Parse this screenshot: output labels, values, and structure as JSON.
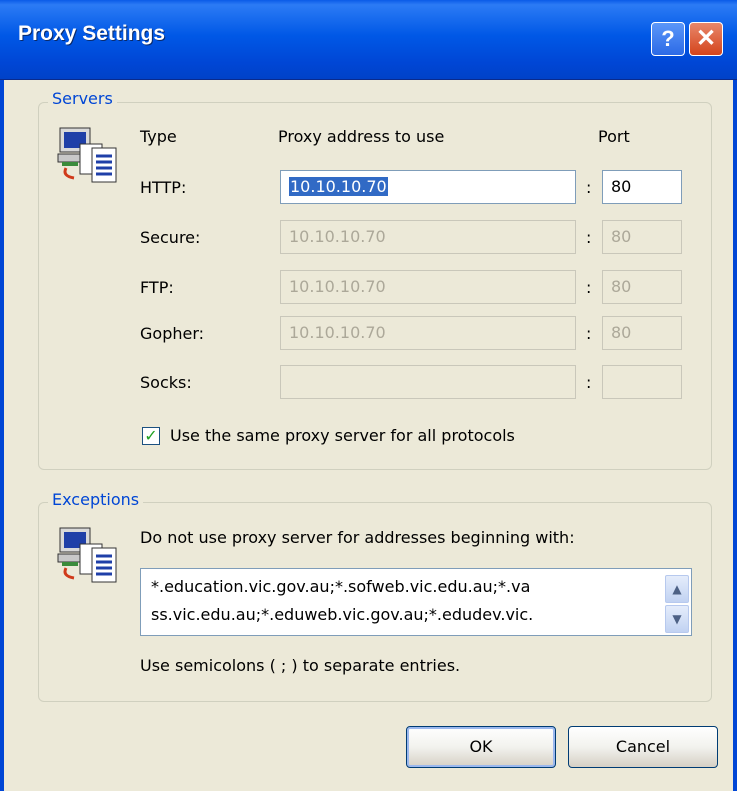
{
  "window": {
    "title": "Proxy Settings",
    "help_label": "?",
    "close_label": "✕"
  },
  "servers": {
    "legend": "Servers",
    "type_header": "Type",
    "address_header": "Proxy address to use",
    "port_header": "Port",
    "rows": [
      {
        "type": "HTTP:",
        "address": "10.10.10.70",
        "port": "80",
        "enabled": true
      },
      {
        "type": "Secure:",
        "address": "10.10.10.70",
        "port": "80",
        "enabled": false
      },
      {
        "type": "FTP:",
        "address": "10.10.10.70",
        "port": "80",
        "enabled": false
      },
      {
        "type": "Gopher:",
        "address": "10.10.10.70",
        "port": "80",
        "enabled": false
      },
      {
        "type": "Socks:",
        "address": "",
        "port": "",
        "enabled": false
      }
    ],
    "colon": ":",
    "same_proxy_label": "Use the same proxy server for all protocols",
    "same_proxy_checked": true
  },
  "exceptions": {
    "legend": "Exceptions",
    "description": "Do not use proxy server for addresses beginning with:",
    "value_line1": "*.education.vic.gov.au;*.sofweb.vic.edu.au;*.va",
    "value_line2": "ss.vic.edu.au;*.eduweb.vic.gov.au;*.edudev.vic.",
    "hint": "Use semicolons ( ; ) to separate entries."
  },
  "buttons": {
    "ok": "OK",
    "cancel": "Cancel"
  },
  "colors": {
    "title_bar": "#0046D5",
    "dialog_bg": "#ECE9D8",
    "legend_text": "#0046D5",
    "selection": "#316AC5"
  }
}
